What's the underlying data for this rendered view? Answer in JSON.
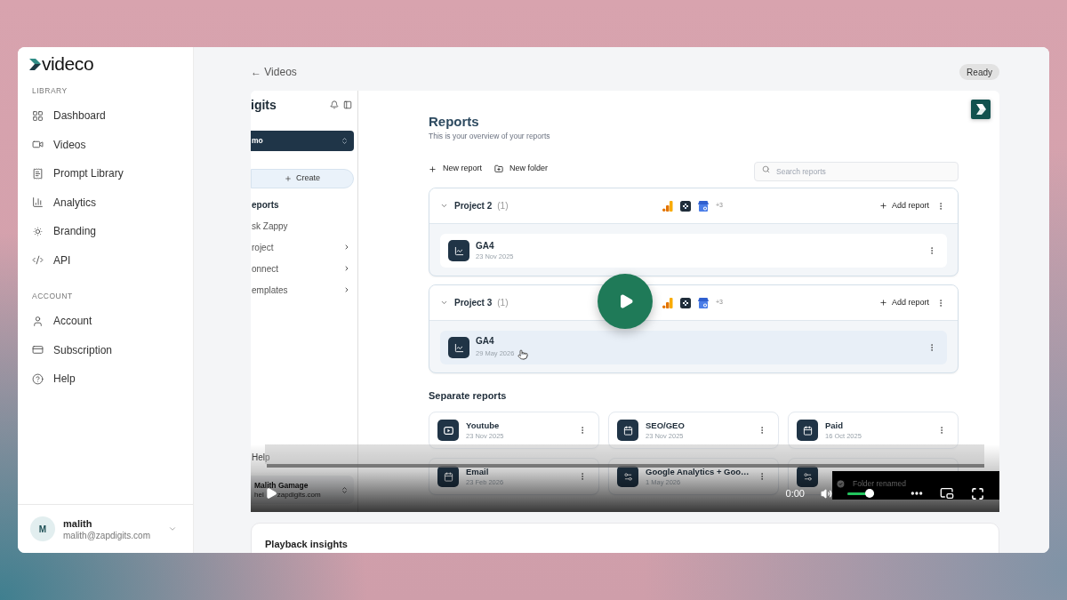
{
  "sidebar": {
    "logo": "videco",
    "sections": [
      {
        "heading": "LIBRARY",
        "items": [
          {
            "label": "Dashboard",
            "selected": false
          },
          {
            "label": "Videos",
            "selected": false
          },
          {
            "label": "Prompt Library",
            "selected": false
          },
          {
            "label": "Analytics",
            "selected": false
          },
          {
            "label": "Branding",
            "selected": false
          },
          {
            "label": "API",
            "selected": false
          }
        ]
      },
      {
        "heading": "ACCOUNT",
        "items": [
          {
            "label": "Account",
            "selected": false
          },
          {
            "label": "Subscription",
            "selected": false
          },
          {
            "label": "Help",
            "selected": false
          }
        ]
      }
    ],
    "user": {
      "initial": "M",
      "name": "malith",
      "email": "malith@zapdigits.com"
    }
  },
  "header": {
    "back_link": "← Videos",
    "status": "Ready"
  },
  "video": {
    "screen": {
      "sidebar": {
        "logo": "igits",
        "workspace": "mo",
        "create_label": "Create",
        "nav": [
          {
            "label": "eports",
            "selected": true,
            "submenu": false
          },
          {
            "label": "sk Zappy",
            "selected": false,
            "submenu": false
          },
          {
            "label": "roject",
            "selected": false,
            "submenu": true
          },
          {
            "label": "onnect",
            "selected": false,
            "submenu": true
          },
          {
            "label": "emplates",
            "selected": false,
            "submenu": true
          }
        ],
        "help": "Help",
        "user": {
          "name": "Malith Gamage",
          "email_parts": [
            "hel",
            "zapdigits.com"
          ]
        }
      },
      "title": "Reports",
      "subtitle": "This is your overview of your reports",
      "actions": [
        {
          "label": "New report"
        },
        {
          "label": "New folder"
        }
      ],
      "search": {
        "placeholder": "Search reports"
      },
      "projects": [
        {
          "name": "Project 2",
          "count": "(1)",
          "expanded": true,
          "more_sources": "+3",
          "add_label": "Add report",
          "reports": [
            {
              "name": "GA4",
              "date": "23 Nov 2025",
              "hovered": false
            }
          ]
        },
        {
          "name": "Project 3",
          "count": "(1)",
          "expanded": true,
          "more_sources": "+3",
          "add_label": "Add report",
          "reports": [
            {
              "name": "GA4",
              "date": "29 May 2026",
              "hovered": true
            }
          ]
        }
      ],
      "separate_title": "Separate reports",
      "separate_reports": [
        {
          "name": "Youtube",
          "date": "23 Nov 2025",
          "kind": "video"
        },
        {
          "name": "SEO/GEO",
          "date": "23 Nov 2025",
          "kind": "calendar"
        },
        {
          "name": "Paid",
          "date": "16 Oct 2025",
          "kind": "calendar"
        },
        {
          "name": "Email",
          "date": "23 Feb 2026",
          "kind": "calendar"
        },
        {
          "name": "Google Analytics + Goo…",
          "date": "1 May 2026",
          "kind": "sliders"
        },
        {
          "kind": "sliders"
        }
      ],
      "toast": "Folder renamed"
    },
    "controls": {
      "time": "0:00",
      "progress": {
        "level": 0
      },
      "volume": {
        "level": 1
      }
    }
  },
  "insights": {
    "title": "Playback insights"
  }
}
